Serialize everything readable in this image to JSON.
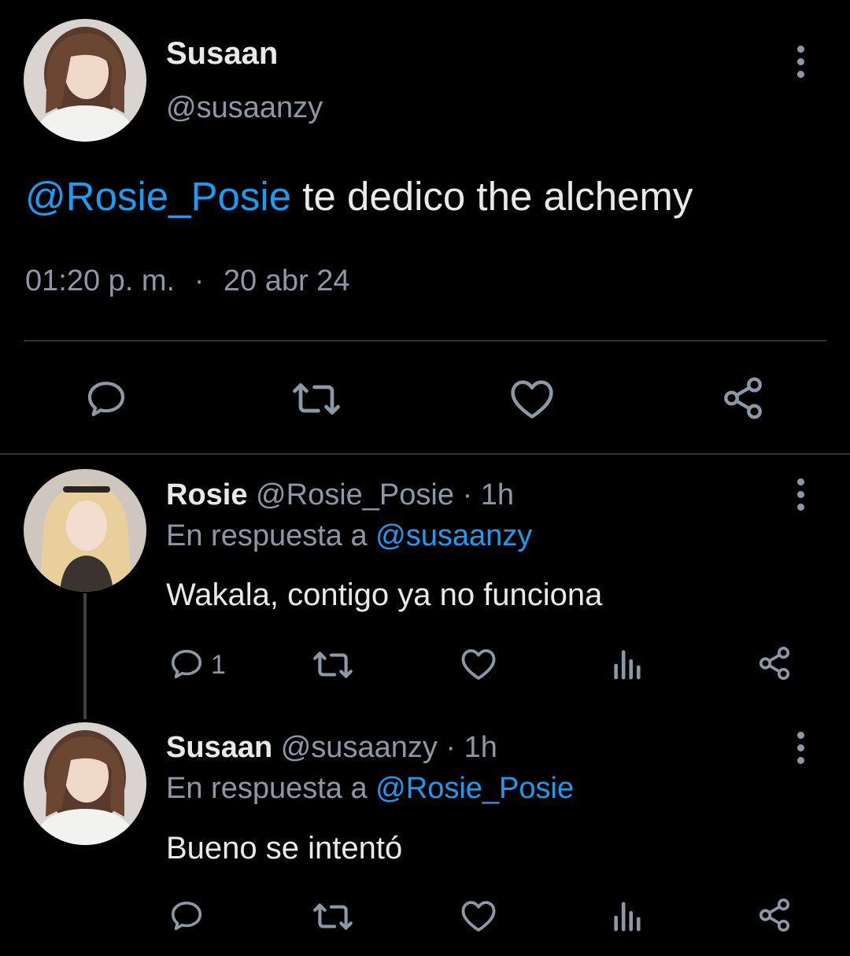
{
  "main_tweet": {
    "display_name": "Susaan",
    "handle": "@susaanzy",
    "mention": "@Rosie_Posie",
    "text": " te dedico the alchemy",
    "time": "01:20 p. m.",
    "separator": "·",
    "date": "20 abr 24",
    "actions": [
      "reply-icon",
      "retweet-icon",
      "like-icon",
      "share-icon"
    ]
  },
  "replies": [
    {
      "display_name": "Rosie",
      "handle": "@Rosie_Posie",
      "age": "· 1h",
      "reply_prefix": "En respuesta a ",
      "reply_to": "@susaanzy",
      "text": "Wakala, contigo ya no funciona",
      "reply_count": "1",
      "actions": [
        "reply-icon",
        "retweet-icon",
        "like-icon",
        "views-icon",
        "share-icon"
      ]
    },
    {
      "display_name": "Susaan",
      "handle": "@susaanzy",
      "age": "· 1h",
      "reply_prefix": "En respuesta a ",
      "reply_to": "@Rosie_Posie",
      "text": "Bueno se intentó",
      "reply_count": "",
      "actions": [
        "reply-icon",
        "retweet-icon",
        "like-icon",
        "views-icon",
        "share-icon"
      ]
    }
  ],
  "colors": {
    "background": "#000000",
    "text": "#e7e9ea",
    "muted": "#8b98a5",
    "accent": "#1d9bf0",
    "divider": "#2f3336"
  }
}
